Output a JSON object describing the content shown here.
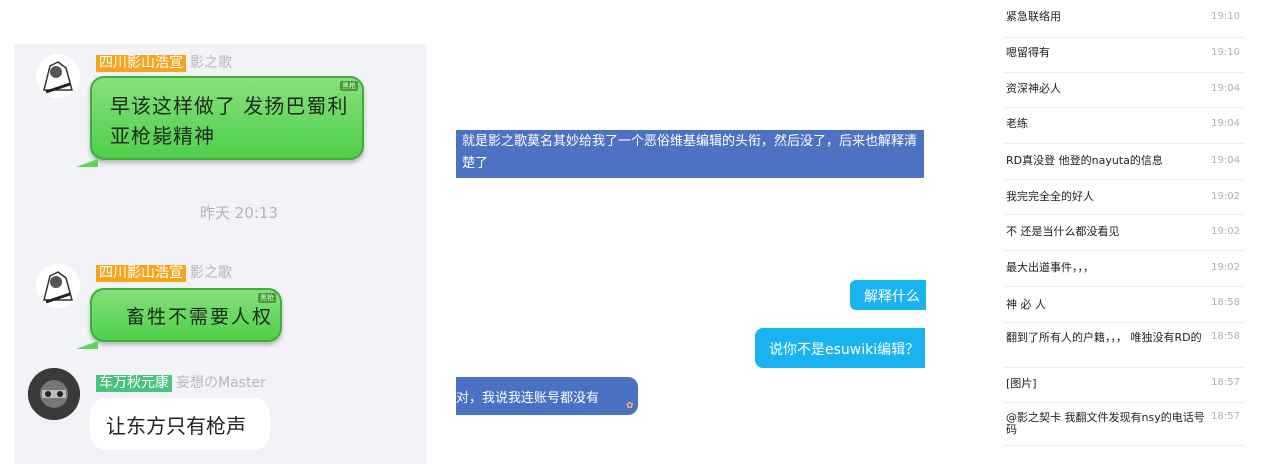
{
  "left_panel": {
    "messages": [
      {
        "rank": "四川影山浩宣",
        "name": "影之歌",
        "text_line1": "早该这样做了 发扬巴蜀利",
        "text_line2": "亚枪毙精神",
        "tag": "黑枪"
      },
      {
        "rank": "四川影山浩宣",
        "name": "影之歌",
        "text": "畜牲不需要人权",
        "tag": "黑枪"
      },
      {
        "rank": "车万秋元康",
        "name": "妄想のMaster",
        "text": "让东方只有枪声"
      }
    ],
    "timestamp": "昨天 20:13"
  },
  "middle_panel": {
    "banner_text": "就是影之歌莫名其妙给我了一个恶俗维基编辑的头衔，然后没了，后来也解释清楚了",
    "bubble_1": "解释什么",
    "bubble_2": "说你不是esuwiki编辑？",
    "bubble_3": "对，我说我连账号都没有"
  },
  "chat_list": [
    {
      "text": "紧急联络用",
      "time": "19:10"
    },
    {
      "text": "嗯留得有",
      "time": "19:10"
    },
    {
      "text": "资深神必人",
      "time": "19:04"
    },
    {
      "text": "老练",
      "time": "19:04"
    },
    {
      "text": "RD真没登 他登的nayuta的信息",
      "time": "19:04"
    },
    {
      "text": "我完完全全的好人",
      "time": "19:02"
    },
    {
      "text": "不 还是当什么都没看见",
      "time": "19:02"
    },
    {
      "text": "最大出道事件，，，",
      "time": "19:02"
    },
    {
      "text": "神 必 人",
      "time": "18:58"
    },
    {
      "text": "翻到了所有人的户籍，，， 唯独没有RD的",
      "time": "18:58"
    },
    {
      "text": "[图片]",
      "time": "18:57"
    },
    {
      "text": "@影之契卡 我翻文件发现有nsy的电话号码",
      "time": "18:57"
    }
  ]
}
